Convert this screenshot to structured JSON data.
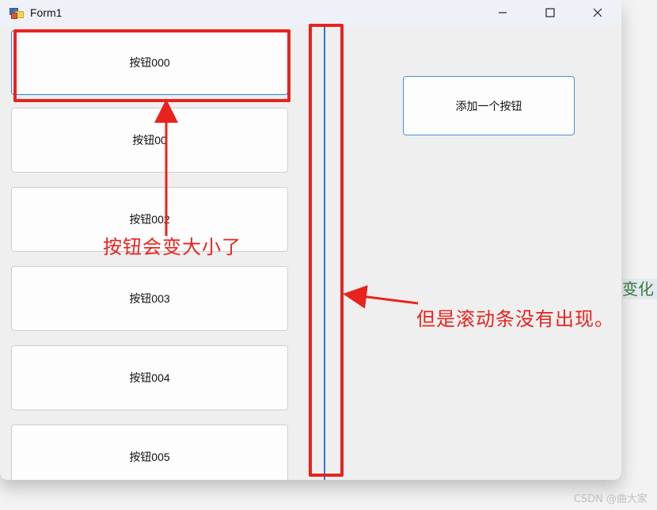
{
  "window": {
    "title": "Form1",
    "controls": {
      "minimize": "—",
      "maximize": "☐",
      "close": "✕"
    }
  },
  "left_panel": {
    "buttons": [
      {
        "label": "按钮000"
      },
      {
        "label": "按钮00"
      },
      {
        "label": "按钮002"
      },
      {
        "label": "按钮003"
      },
      {
        "label": "按钮004"
      },
      {
        "label": "按钮005"
      }
    ]
  },
  "right_panel": {
    "add_button_label": "添加一个按钮"
  },
  "annotations": {
    "resize_note": "按钮会变大小了",
    "scrollbar_note": "但是滚动条没有出现。",
    "color": "#e8231e"
  },
  "background": {
    "side_text": "变化"
  },
  "watermark": "CSDN @曲大家",
  "colors": {
    "accent_blue": "#2b78d0",
    "annotation_red": "#e8231e"
  }
}
